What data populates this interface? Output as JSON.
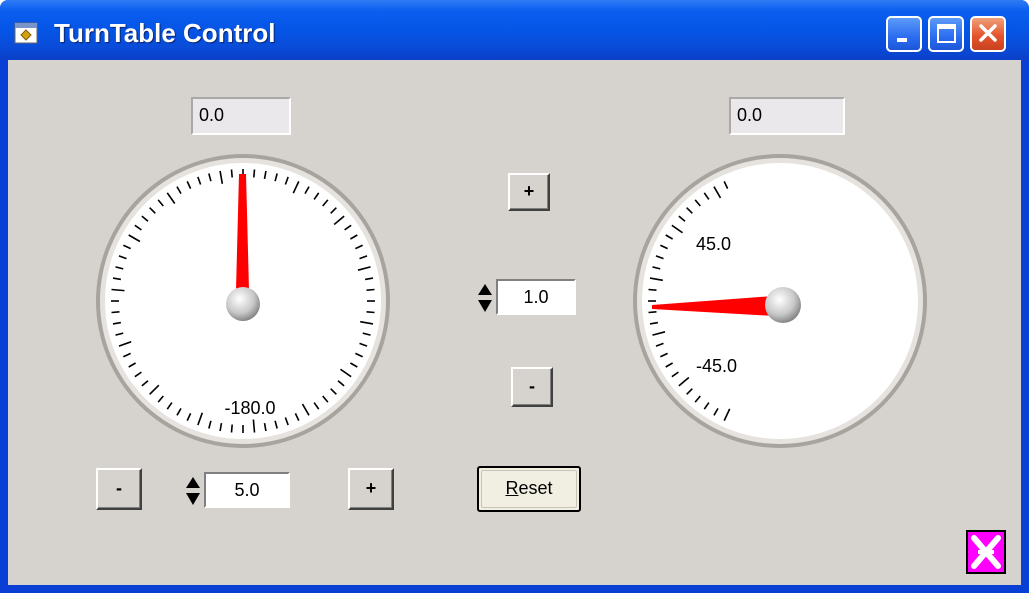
{
  "window": {
    "title": "TurnTable Control"
  },
  "left_panel": {
    "readout": "0.0",
    "dial_label": "-180.0",
    "minus_label": "-",
    "plus_label": "+",
    "step_value": "5.0"
  },
  "center_panel": {
    "plus_label": "+",
    "minus_label": "-",
    "step_value": "1.0",
    "reset_label": "Reset"
  },
  "right_panel": {
    "readout": "0.0",
    "label_upper": "45.0",
    "label_lower": "-45.0"
  },
  "colors": {
    "needle": "#ff0000",
    "titlebar": "#0555e6",
    "face": "#d6d3ce",
    "corner_icon": "#ff00ff"
  },
  "icons": [
    "app-icon",
    "minimize-icon",
    "maximize-icon",
    "close-icon",
    "spin-up-icon",
    "spin-down-icon",
    "exit-icon"
  ]
}
